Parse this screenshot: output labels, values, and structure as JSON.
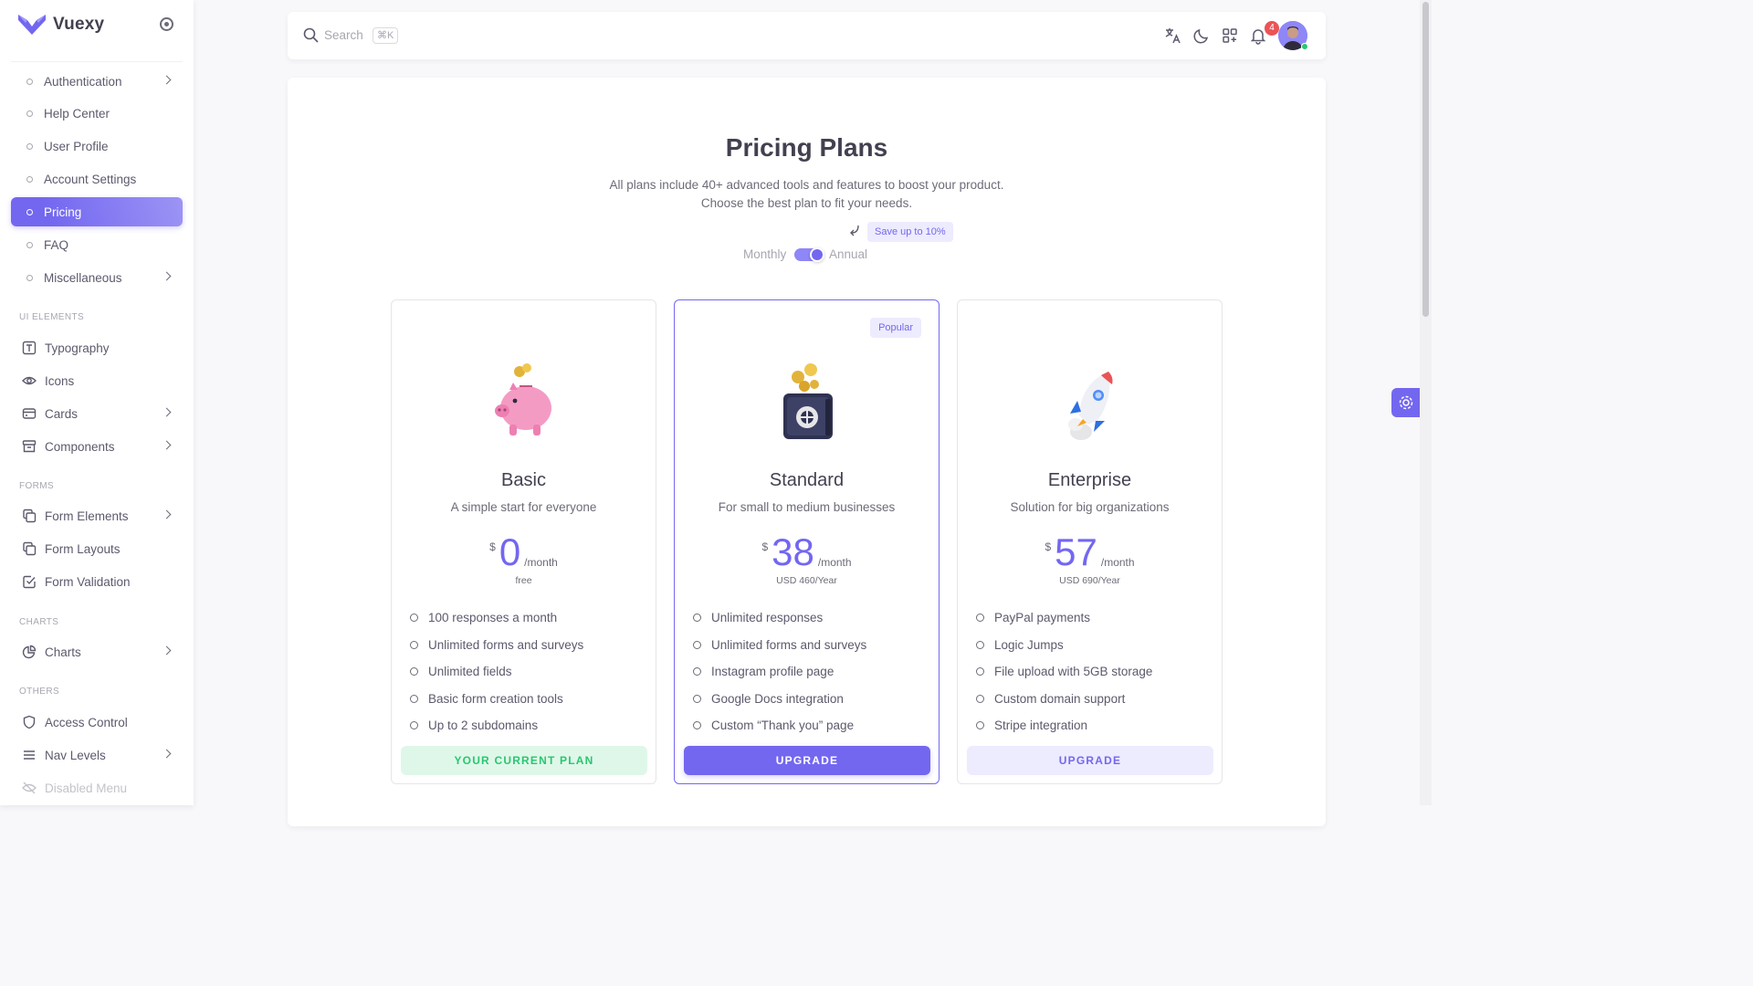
{
  "brand": {
    "name": "Vuexy"
  },
  "sidebar": {
    "items": [
      {
        "label": "Authentication",
        "has_submenu": true
      },
      {
        "label": "Help Center"
      },
      {
        "label": "User Profile"
      },
      {
        "label": "Account Settings"
      },
      {
        "label": "Pricing",
        "active": true
      },
      {
        "label": "FAQ"
      },
      {
        "label": "Miscellaneous",
        "has_submenu": true
      }
    ],
    "sections": {
      "ui": "UI ELEMENTS",
      "forms": "FORMS",
      "charts": "CHARTS",
      "others": "OTHERS"
    },
    "ui_items": [
      {
        "label": "Typography",
        "icon": "typography-icon"
      },
      {
        "label": "Icons",
        "icon": "eye-icon"
      },
      {
        "label": "Cards",
        "icon": "card-icon",
        "has_submenu": true
      },
      {
        "label": "Components",
        "icon": "archive-icon",
        "has_submenu": true
      }
    ],
    "form_items": [
      {
        "label": "Form Elements",
        "icon": "copy-icon",
        "has_submenu": true
      },
      {
        "label": "Form Layouts",
        "icon": "copy-icon"
      },
      {
        "label": "Form Validation",
        "icon": "checkbox-icon"
      }
    ],
    "chart_items": [
      {
        "label": "Charts",
        "icon": "chart-pie-icon",
        "has_submenu": true
      }
    ],
    "other_items": [
      {
        "label": "Access Control",
        "icon": "shield-icon"
      },
      {
        "label": "Nav Levels",
        "icon": "menu-icon",
        "has_submenu": true
      },
      {
        "label": "Disabled Menu",
        "icon": "eye-off-icon",
        "disabled": true
      }
    ]
  },
  "navbar": {
    "search_placeholder": "Search",
    "search_shortcut": "⌘K",
    "notification_count": "4",
    "icons": [
      "translate-icon",
      "moon-icon",
      "apps-grid-icon",
      "bell-icon"
    ]
  },
  "pricing": {
    "title": "Pricing Plans",
    "subtitle_line1": "All plans include 40+ advanced tools and features to boost your product.",
    "subtitle_line2": "Choose the best plan to fit your needs.",
    "save_badge": "Save up to 10%",
    "toggle_monthly": "Monthly",
    "toggle_annual": "Annual",
    "toggle_state": "annual",
    "plans": [
      {
        "name": "Basic",
        "description": "A simple start for everyone",
        "currency": "$",
        "price": "0",
        "period": "/month",
        "note": "free",
        "illustration": "piggy-bank-icon",
        "features": [
          "100 responses a month",
          "Unlimited forms and surveys",
          "Unlimited fields",
          "Basic form creation tools",
          "Up to 2 subdomains"
        ],
        "button": "YOUR CURRENT PLAN"
      },
      {
        "name": "Standard",
        "description": "For small to medium businesses",
        "currency": "$",
        "price": "38",
        "period": "/month",
        "note": "USD 460/Year",
        "badge": "Popular",
        "illustration": "safe-box-icon",
        "features": [
          "Unlimited responses",
          "Unlimited forms and surveys",
          "Instagram profile page",
          "Google Docs integration",
          "Custom “Thank you” page"
        ],
        "button": "UPGRADE"
      },
      {
        "name": "Enterprise",
        "description": "Solution for big organizations",
        "currency": "$",
        "price": "57",
        "period": "/month",
        "note": "USD 690/Year",
        "illustration": "rocket-icon",
        "features": [
          "PayPal payments",
          "Logic Jumps",
          "File upload with 5GB storage",
          "Custom domain support",
          "Stripe integration"
        ],
        "button": "UPGRADE"
      }
    ]
  },
  "colors": {
    "primary": "#7367f0",
    "success": "#28c76f",
    "danger": "#ea5455",
    "text": "#5d596c",
    "heading": "#444050"
  }
}
